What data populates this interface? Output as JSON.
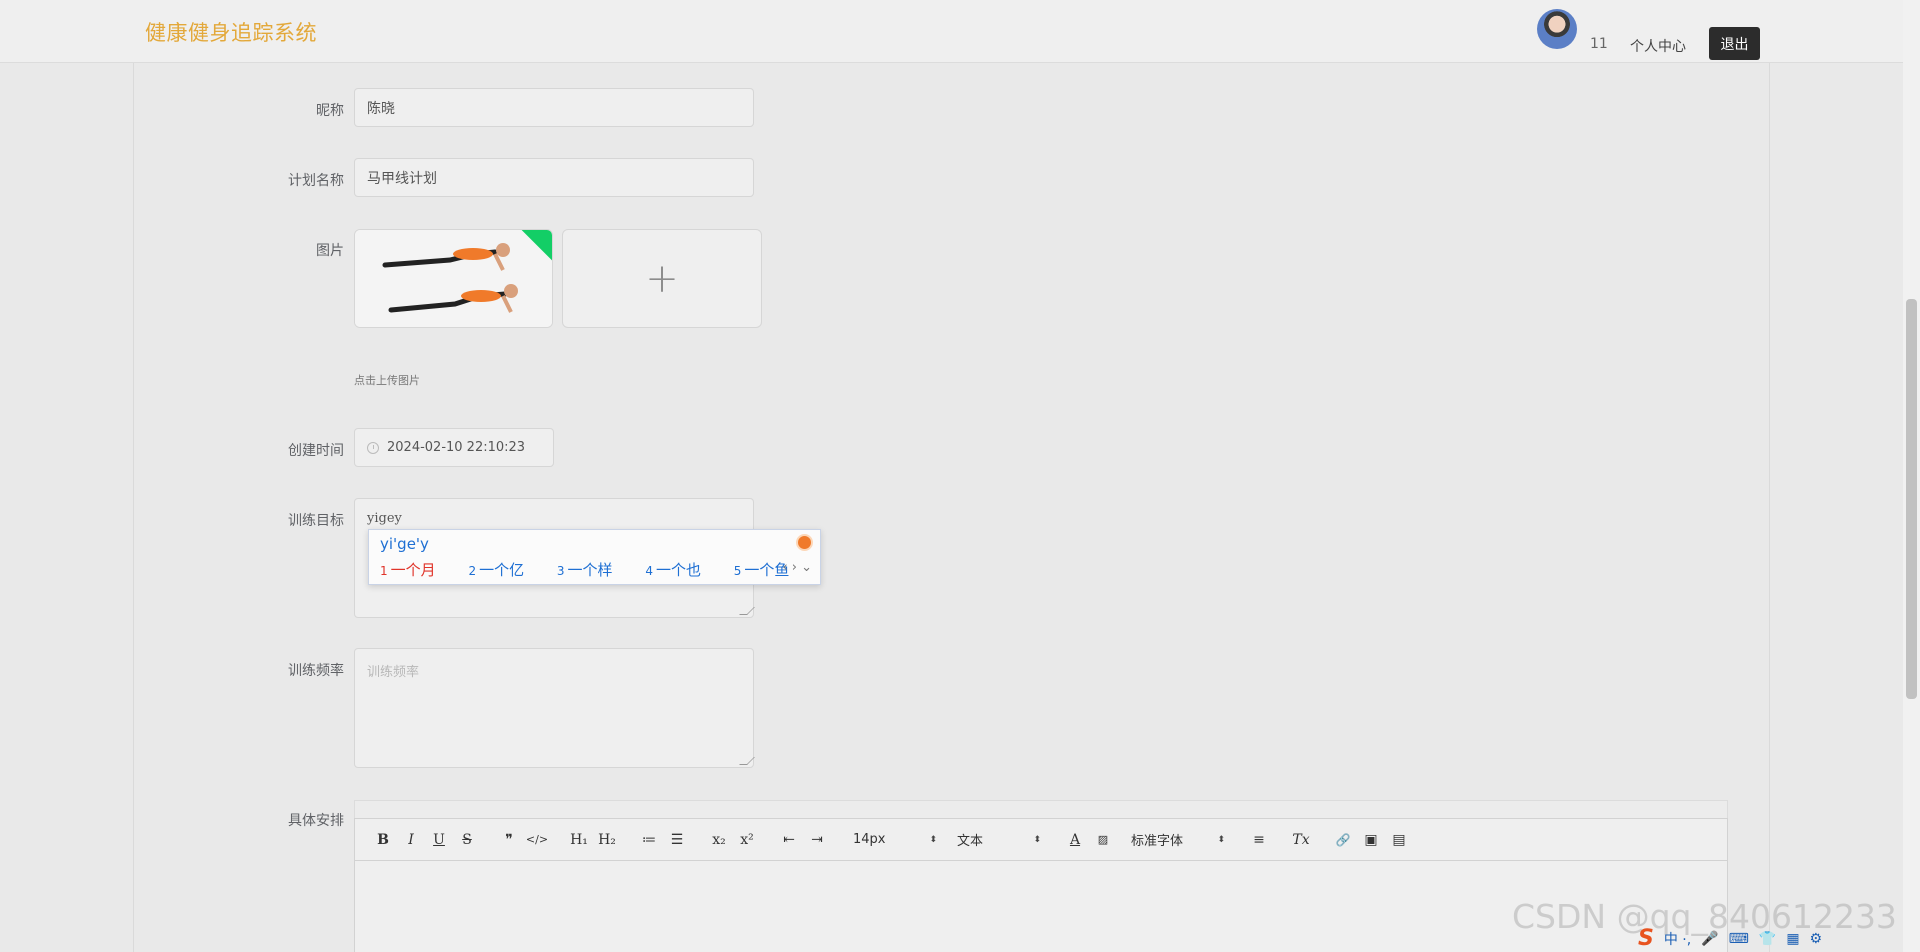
{
  "header": {
    "brand": "健康健身追踪系统",
    "user_id": "11",
    "user_center": "个人中心",
    "logout": "退出"
  },
  "form": {
    "nickname": {
      "label": "昵称",
      "value": "陈晓"
    },
    "plan_name": {
      "label": "计划名称",
      "value": "马甲线计划"
    },
    "image": {
      "label": "图片",
      "upload_tip": "点击上传图片",
      "add_icon": "+"
    },
    "created_time": {
      "label": "创建时间",
      "value": "2024-02-10 22:10:23"
    },
    "goal": {
      "label": "训练目标",
      "value": "yigey"
    },
    "frequency": {
      "label": "训练频率",
      "placeholder": "训练频率"
    },
    "schedule": {
      "label": "具体安排"
    }
  },
  "ime": {
    "composition": "yi'ge'y",
    "candidates": [
      {
        "num": "1",
        "text": "一个月"
      },
      {
        "num": "2",
        "text": "一个亿"
      },
      {
        "num": "3",
        "text": "一个样"
      },
      {
        "num": "4",
        "text": "一个也"
      },
      {
        "num": "5",
        "text": "一个鱼"
      }
    ],
    "nav": "‹ › ⌄"
  },
  "editor": {
    "toolbar": {
      "bold": "B",
      "italic": "I",
      "underline": "U",
      "strike": "S",
      "quote": "❞",
      "code": "</>",
      "h1": "H₁",
      "h2": "H₂",
      "ordered_list": "≔",
      "bullet_list": "☰",
      "subscript": "x₂",
      "superscript": "x²",
      "outdent": "⇤",
      "indent": "⇥",
      "size": "14px",
      "header_select": "文本",
      "font_select": "标准字体",
      "align": "≡",
      "clean": "Tx",
      "link": "🔗",
      "image": "▣",
      "video": "▤"
    }
  },
  "watermark": "CSDN @qq_840612233",
  "tray": {
    "ime_mode": "中 ·,",
    "logo": "S"
  }
}
